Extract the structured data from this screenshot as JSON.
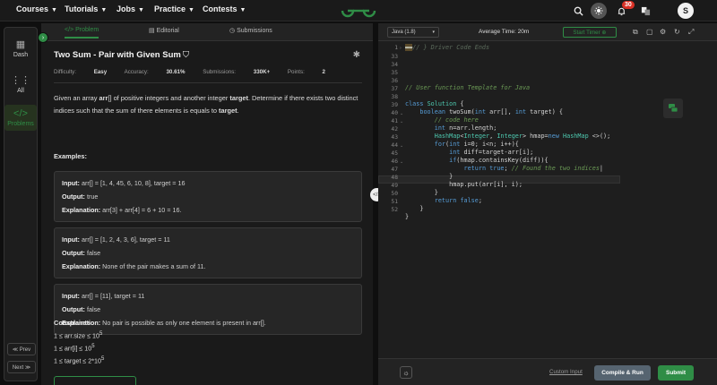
{
  "nav": {
    "items": [
      "Courses",
      "Tutorials",
      "Jobs",
      "Practice",
      "Contests"
    ],
    "notification_count": "30",
    "avatar_letter": "S"
  },
  "sidebar": {
    "items": [
      {
        "label": "Dash",
        "icon": "grid-icon"
      },
      {
        "label": "All",
        "icon": "apps-icon"
      },
      {
        "label": "Problems",
        "icon": "code-icon"
      }
    ],
    "prev_label": "≪ Prev",
    "next_label": "Next ≫"
  },
  "tabs": [
    "Problem",
    "Editorial",
    "Submissions"
  ],
  "problem": {
    "title": "Two Sum - Pair with Given Sum",
    "difficulty_label": "Difficulty:",
    "difficulty": "Easy",
    "accuracy_label": "Accuracy:",
    "accuracy": "30.61%",
    "submissions_label": "Submissions:",
    "submissions": "330K+",
    "points_label": "Points:",
    "points": "2",
    "desc_1": "Given an array ",
    "desc_arr": "arr",
    "desc_2": "[] of positive integers and another integer ",
    "desc_target": "target",
    "desc_3": ". Determine if there exists two distinct indices such that the sum of there elements is equals to ",
    "desc_target2": "target",
    "desc_4": ".",
    "examples_heading": "Examples:",
    "input_label": "Input:",
    "output_label": "Output:",
    "explanation_label": "Explanation:",
    "examples": [
      {
        "input": "arr[] = [1, 4, 45, 6, 10, 8], target = 16",
        "output": "true",
        "explanation": "arr[3] + arr[4] = 6 + 10 = 16."
      },
      {
        "input": "arr[] = [1, 2, 4, 3, 6], target = 11",
        "output": "false",
        "explanation": "None of the pair makes a sum of 11."
      },
      {
        "input": "arr[] = [11], target = 11",
        "output": "false",
        "explanation": "No pair is possible as only one element is present in arr[]."
      }
    ],
    "constraints_heading": "Constraints:",
    "constraints": [
      {
        "text": "1 ≤ arr.size ≤ 10",
        "sup": "5"
      },
      {
        "text": "1 ≤ arr[i] ≤ 10",
        "sup": "5"
      },
      {
        "text": "1 ≤ target ≤ 2*10",
        "sup": "5"
      }
    ]
  },
  "editor": {
    "language": "Java (1.8)",
    "avg_time": "Average Time: 20m",
    "start_timer": "Start Timer",
    "line_numbers": [
      "1",
      "33",
      "34",
      "35",
      "36",
      "37",
      "38",
      "39",
      "40",
      "41",
      "42",
      "43",
      "44",
      "45",
      "46",
      "47",
      "48",
      "49",
      "50",
      "51",
      "52"
    ],
    "custom_input": "Custom Input",
    "compile_run": "Compile & Run",
    "submit": "Submit"
  },
  "colors": {
    "accent": "#2f8d46",
    "bg": "#1a1a1a"
  }
}
